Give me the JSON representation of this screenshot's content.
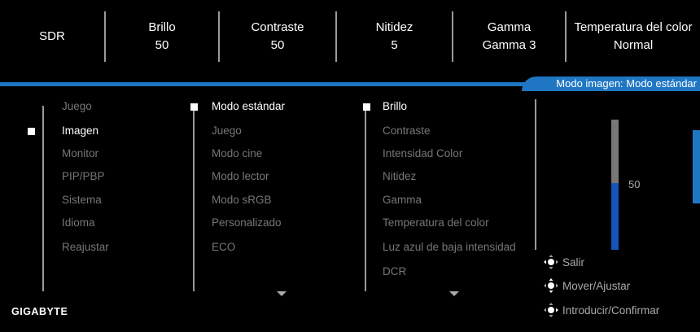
{
  "topbar": {
    "items": [
      {
        "label": "SDR",
        "value": ""
      },
      {
        "label": "Brillo",
        "value": "50"
      },
      {
        "label": "Contraste",
        "value": "50"
      },
      {
        "label": "Nitidez",
        "value": "5"
      },
      {
        "label": "Gamma",
        "value": "Gamma 3"
      },
      {
        "label": "Temperatura del color",
        "value": "Normal"
      }
    ]
  },
  "mode_tab": "Modo imagen: Modo estándar",
  "menu": {
    "main": [
      "Juego",
      "Imagen",
      "Monitor",
      "PIP/PBP",
      "Sistema",
      "Idioma",
      "Reajustar"
    ],
    "main_selected": "Imagen",
    "sub": [
      "Modo estándar",
      "Juego",
      "Modo cine",
      "Modo lector",
      "Modo sRGB",
      "Personalizado",
      "ECO"
    ],
    "sub_selected": "Modo estándar",
    "settings": [
      "Brillo",
      "Contraste",
      "Intensidad Color",
      "Nitidez",
      "Gamma",
      "Temperatura del color",
      "Luz azul de baja intensidad",
      "DCR"
    ],
    "settings_selected": "Brillo"
  },
  "slider": {
    "value": "50",
    "fraction": 0.5
  },
  "hints": [
    "Salir",
    "Mover/Ajustar",
    "Introducir/Confirmar"
  ],
  "brand": "GIGABYTE",
  "colors": {
    "accent": "#1f77c4",
    "slider_fill": "#1556b8",
    "background": "#000000"
  }
}
